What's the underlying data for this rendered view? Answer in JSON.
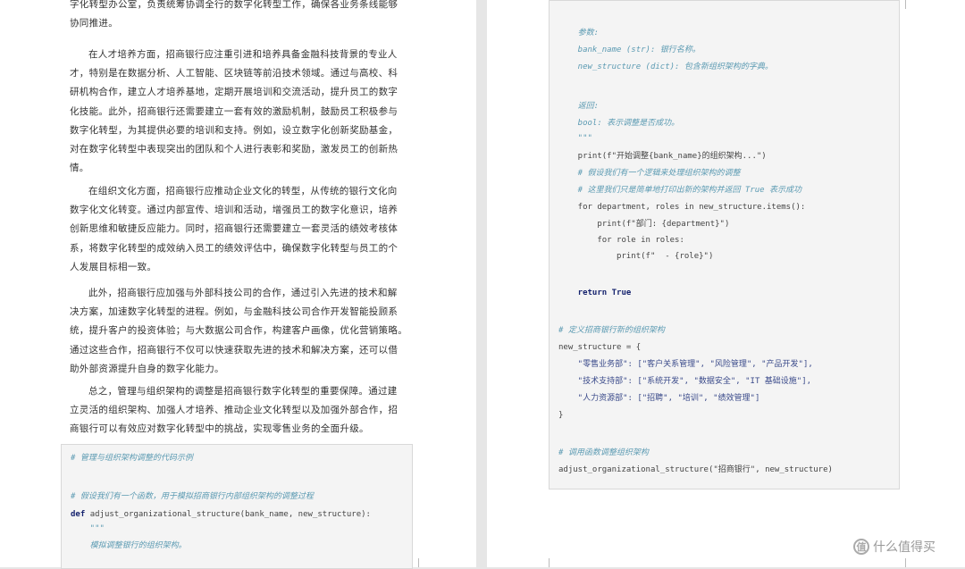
{
  "left_page": {
    "paragraphs": [
      {
        "lines": [
          "字化转型办公室，负责统筹协调全行的数字化转型工作，确保各业务条线能够",
          "协同推进。"
        ]
      },
      {
        "lines": [
          "在人才培养方面，招商银行应注重引进和培养具备金融科技背景的专业人",
          "才，特别是在数据分析、人工智能、区块链等前沿技术领域。通过与高校、科",
          "研机构合作，建立人才培养基地，定期开展培训和交流活动，提升员工的数字",
          "化技能。此外，招商银行还需要建立一套有效的激励机制，鼓励员工积极参与",
          "数字化转型，为其提供必要的培训和支持。例如，设立数字化创新奖励基金，",
          "对在数字化转型中表现突出的团队和个人进行表彰和奖励，激发员工的创新热",
          "情。"
        ]
      },
      {
        "lines": [
          "在组织文化方面，招商银行应推动企业文化的转型，从传统的银行文化向",
          "数字化文化转变。通过内部宣传、培训和活动，增强员工的数字化意识，培养",
          "创新思维和敏捷反应能力。同时，招商银行还需要建立一套灵活的绩效考核体",
          "系，将数字化转型的成效纳入员工的绩效评估中，确保数字化转型与员工的个",
          "人发展目标相一致。"
        ]
      },
      {
        "lines": [
          "此外，招商银行应加强与外部科技公司的合作，通过引入先进的技术和解",
          "决方案，加速数字化转型的进程。例如，与金融科技公司合作开发智能投顾系",
          "统，提升客户的投资体验；与大数据公司合作，构建客户画像，优化营销策略。",
          "通过这些合作，招商银行不仅可以快速获取先进的技术和解决方案，还可以借",
          "助外部资源提升自身的数字化能力。"
        ]
      },
      {
        "lines": [
          "总之，管理与组织架构的调整是招商银行数字化转型的重要保障。通过建",
          "立灵活的组织架构、加强人才培养、推动企业文化转型以及加强外部合作，招",
          "商银行可以有效应对数字化转型中的挑战，实现零售业务的全面升级。"
        ]
      }
    ],
    "code_lines": [
      "# 管理与组织架构调整的代码示例",
      "",
      "# 假设我们有一个函数，用于模拟招商银行内部组织架构的调整过程",
      "def adjust_organizational_structure(bank_name, new_structure):",
      "    \"\"\"",
      "    模拟调整银行的组织架构。"
    ]
  },
  "right_page": {
    "code_lines": [
      "    参数:",
      "    bank_name (str): 银行名称。",
      "    new_structure (dict): 包含新组织架构的字典。",
      "",
      "",
      "    返回:",
      "    bool: 表示调整是否成功。",
      "    \"\"\"",
      "    print(f\"开始调整{bank_name}的组织架构...\")",
      "    # 假设我们有一个逻辑来处理组织架构的调整",
      "    # 这里我们只是简单地打印出新的架构并返回 True 表示成功",
      "    for department, roles in new_structure.items():",
      "        print(f\"部门: {department}\")",
      "        for role in roles:",
      "            print(f\"  - {role}\")",
      "",
      "",
      "    return True",
      "",
      "",
      "# 定义招商银行新的组织架构",
      "new_structure = {",
      "    \"零售业务部\": [\"客户关系管理\", \"风险管理\", \"产品开发\"],",
      "    \"技术支持部\": [\"系统开发\", \"数据安全\", \"IT 基础设施\"],",
      "    \"人力资源部\": [\"招聘\", \"培训\", \"绩效管理\"]",
      "}",
      "",
      "",
      "# 调用函数调整组织架构",
      "adjust_organizational_structure(\"招商银行\", new_structure)"
    ]
  },
  "watermark": {
    "text": "什么值得买",
    "icon": "zhi-icon",
    "icon_glyph": "值"
  }
}
